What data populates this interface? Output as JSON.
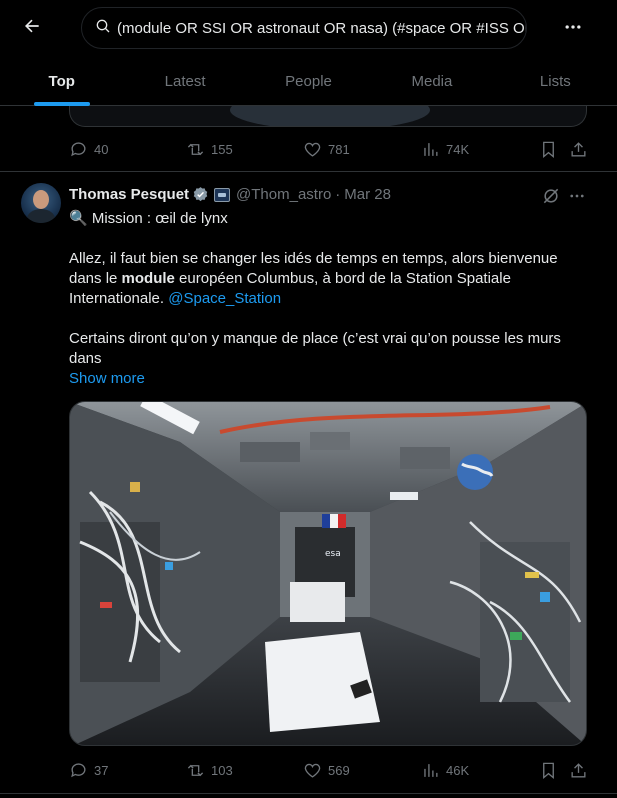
{
  "header": {
    "search_query": "(module OR SSI OR astronaut OR nasa) (#space OR #ISS OR #",
    "tabs": [
      {
        "label": "Top",
        "active": true
      },
      {
        "label": "Latest",
        "active": false
      },
      {
        "label": "People",
        "active": false
      },
      {
        "label": "Media",
        "active": false
      },
      {
        "label": "Lists",
        "active": false
      }
    ]
  },
  "previous_tweet": {
    "replies": "40",
    "reposts": "155",
    "likes": "781",
    "views": "74K"
  },
  "tweet": {
    "author_name": "Thomas Pesquet",
    "handle": "@Thom_astro",
    "date": "Mar 28",
    "line1": "🔍 Mission : œil de lynx",
    "para1_a": "Allez, il faut bien se changer les idés de temps en temps, alors bienvenue dans le ",
    "para1_bold": "module",
    "para1_b": " européen Columbus, à bord de la Station Spatiale Internationale. ",
    "mention": "@Space_Station",
    "para2": "Certains diront qu’on y manque de place (c’est vrai qu’on pousse les murs dans",
    "show_more": "Show more",
    "photo_alt_text": "esa",
    "replies": "37",
    "reposts": "103",
    "likes": "569",
    "views": "46K"
  },
  "colors": {
    "accent": "#1d9bf0",
    "muted": "#71767b",
    "background": "#000000",
    "text": "#e7e9ea"
  }
}
